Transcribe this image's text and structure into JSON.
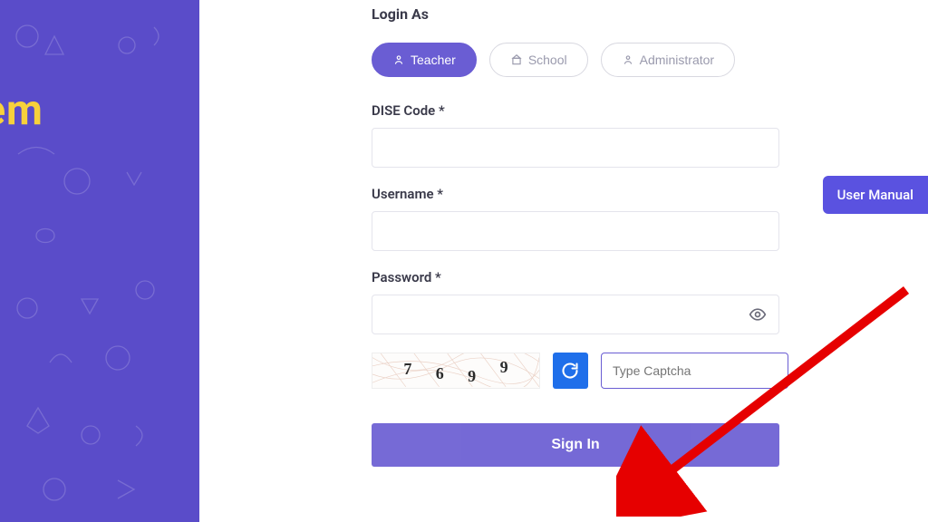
{
  "sidebar": {
    "title_fragment": "stem"
  },
  "form": {
    "login_as_label": "Login As",
    "roles": [
      {
        "label": "Teacher",
        "active": true
      },
      {
        "label": "School",
        "active": false
      },
      {
        "label": "Administrator",
        "active": false
      }
    ],
    "fields": {
      "dise_label": "DISE Code *",
      "username_label": "Username *",
      "password_label": "Password *"
    },
    "captcha": {
      "digits": [
        "7",
        "6",
        "9",
        "9"
      ],
      "placeholder": "Type Captcha"
    },
    "signin_label": "Sign In"
  },
  "user_manual_label": "User Manual",
  "colors": {
    "primary": "#6a5dd3",
    "sidebar_bg": "#5a4cc9",
    "accent_yellow": "#f7d13b",
    "refresh_blue": "#1f6fea"
  }
}
